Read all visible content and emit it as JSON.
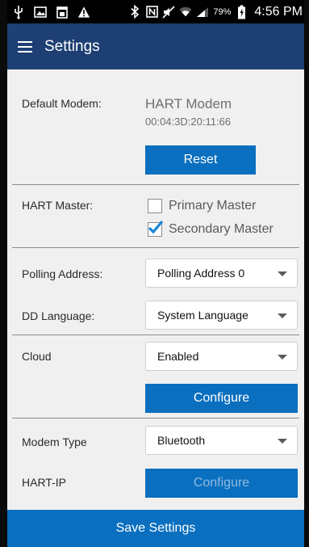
{
  "status_bar": {
    "left_icons": [
      "usb-icon",
      "image-icon",
      "calendar-icon",
      "warning-icon"
    ],
    "right_icons": [
      "bluetooth-icon",
      "nfc-icon",
      "mute-icon",
      "wifi-icon",
      "signal-icon"
    ],
    "battery": "79%",
    "time": "4:56 PM"
  },
  "appbar": {
    "title": "Settings"
  },
  "default_modem": {
    "label": "Default Modem:",
    "name": "HART Modem",
    "address": "00:04:3D:20:11:66",
    "reset_label": "Reset"
  },
  "hart_master": {
    "label": "HART Master:",
    "primary_label": "Primary Master",
    "primary_checked": false,
    "secondary_label": "Secondary Master",
    "secondary_checked": true
  },
  "polling": {
    "label": "Polling Address:",
    "value": "Polling Address 0"
  },
  "dd_language": {
    "label": "DD Language:",
    "value": "System Language"
  },
  "cloud": {
    "label": "Cloud",
    "value": "Enabled",
    "configure_label": "Configure"
  },
  "modem_type": {
    "label": "Modem Type",
    "value": "Bluetooth"
  },
  "hart_ip": {
    "label": "HART-IP",
    "configure_label": "Configure",
    "enabled": false
  },
  "save_label": "Save Settings",
  "colors": {
    "appbar": "#1d3f73",
    "accent": "#0a6fbf",
    "background": "#f0f0f0"
  }
}
